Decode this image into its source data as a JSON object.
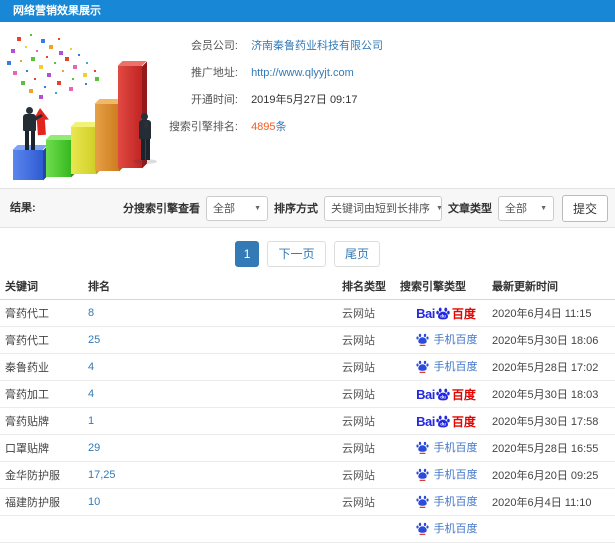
{
  "window": {
    "title": "网络营销效果展示"
  },
  "company": {
    "member_label": "会员公司:",
    "member_value": "济南秦鲁药业科技有限公司",
    "site_label": "推广地址:",
    "site_value": "http://www.qlyyjt.com",
    "opened_label": "开通时间:",
    "opened_value": "2019年5月27日 09:17",
    "rank_label": "搜索引擎排名:",
    "rank_count": "4895",
    "rank_unit": "条"
  },
  "filters": {
    "section_label": "结果:",
    "engine_label": "分搜索引擎查看",
    "engine_value": "全部",
    "sort_label": "排序方式",
    "sort_value": "关键词由短到长排序",
    "article_label": "文章类型",
    "article_value": "全部",
    "submit_label": "提交"
  },
  "pagination": {
    "current": "1",
    "next": "下一页",
    "last": "尾页"
  },
  "engines": {
    "pc_latin": "Bai",
    "pc_cn": "百度",
    "mobile_label": "手机百度"
  },
  "table": {
    "headers": [
      "关键词",
      "排名",
      "排名类型",
      "搜索引擎类型",
      "最新更新时间"
    ],
    "rows": [
      {
        "keyword": "膏药代工",
        "rank": "8",
        "rank_type": "云网站",
        "engine": "baidu_pc",
        "updated": "2020年6月4日 11:15"
      },
      {
        "keyword": "膏药代工",
        "rank": "25",
        "rank_type": "云网站",
        "engine": "baidu_mobile",
        "updated": "2020年5月30日 18:06"
      },
      {
        "keyword": "秦鲁药业",
        "rank": "4",
        "rank_type": "云网站",
        "engine": "baidu_mobile",
        "updated": "2020年5月28日 17:02"
      },
      {
        "keyword": "膏药加工",
        "rank": "4",
        "rank_type": "云网站",
        "engine": "baidu_pc",
        "updated": "2020年5月30日 18:03"
      },
      {
        "keyword": "膏药贴牌",
        "rank": "1",
        "rank_type": "云网站",
        "engine": "baidu_pc",
        "updated": "2020年5月30日 17:58"
      },
      {
        "keyword": "口罩贴牌",
        "rank": "29",
        "rank_type": "云网站",
        "engine": "baidu_mobile",
        "updated": "2020年5月28日 16:55"
      },
      {
        "keyword": "金华防护服",
        "rank": "17,25",
        "rank_type": "云网站",
        "engine": "baidu_mobile",
        "updated": "2020年6月20日 09:25"
      },
      {
        "keyword": "福建防护服",
        "rank": "10",
        "rank_type": "云网站",
        "engine": "baidu_mobile",
        "updated": "2020年6月4日 11:10"
      },
      {
        "keyword": "",
        "rank": "",
        "rank_type": "",
        "engine": "baidu_mobile",
        "updated": ""
      }
    ]
  },
  "colors": {
    "header_bg": "#1787d6",
    "link_blue": "#337ab7",
    "highlight_orange": "#f75b22",
    "baidu_blue": "#2329e0",
    "baidu_red": "#e00602",
    "mobile_blue": "#4176c9"
  }
}
